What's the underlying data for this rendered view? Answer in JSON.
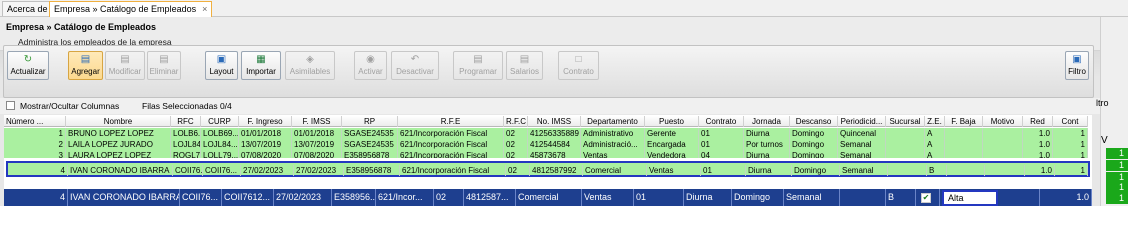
{
  "tabs": [
    {
      "label": "Acerca de"
    },
    {
      "label": "Empresa » Catálogo de Empleados",
      "close": "×"
    }
  ],
  "header": {
    "title": "Empresa » Catálogo de Empleados",
    "subtitle": "Administra los empleados de la empresa"
  },
  "toolbar": {
    "actualizar": "Actualizar",
    "agregar": "Agregar",
    "modificar": "Modificar",
    "eliminar": "Eliminar",
    "layout": "Layout",
    "importar": "Importar",
    "asimilables": "Asimilables",
    "activar": "Activar",
    "desactivar": "Desactivar",
    "programar": "Programar",
    "salarios": "Salarios",
    "contrato": "Contrato",
    "filtro": "Filtro"
  },
  "filter": {
    "toggle_columns": "Mostrar/Ocultar Columnas",
    "selected": "Filas Seleccionadas 0/4"
  },
  "columns": [
    "Número ...",
    "Nombre",
    "RFC",
    "CURP",
    "F. Ingreso",
    "F. IMSS",
    "RP",
    "R.F.E",
    "R.F.C",
    "No. IMSS",
    "Departamento",
    "Puesto",
    "Contrato",
    "Jornada",
    "Descanso",
    "Periodicid...",
    "Sucursal",
    "Z.E.",
    "F. Baja",
    "Motivo",
    "Red",
    "Cont"
  ],
  "rows": [
    [
      "1",
      "BRUNO LOPEZ LOPEZ",
      "LOLB6...",
      "LOLB69...",
      "01/01/2018",
      "01/01/2018",
      "SGASE24535",
      "621/Incorporación Fiscal",
      "02",
      "41256335889",
      "Administrativo",
      "Gerente",
      "01",
      "Diurna",
      "Domingo",
      "Quincenal",
      "",
      "A",
      "",
      "",
      "1.0",
      "1"
    ],
    [
      "2",
      "LAILA LOPEZ JURADO",
      "LOJL84...",
      "LOJL84...",
      "13/07/2019",
      "13/07/2019",
      "SGASE24535",
      "621/Incorporación Fiscal",
      "02",
      "412544584",
      "Administració...",
      "Encargada",
      "01",
      "Por turnos",
      "Domingo",
      "Semanal",
      "",
      "A",
      "",
      "",
      "1.0",
      "1"
    ],
    [
      "3",
      "LAURA LOPEZ LOPEZ",
      "ROGL7...",
      "LOLL79...",
      "07/08/2020",
      "07/08/2020",
      "E358956878",
      "621/Incorporación Fiscal",
      "02",
      "45873678",
      "Ventas",
      "Vendedora",
      "04",
      "Diurna",
      "Domingo",
      "Semanal",
      "",
      "A",
      "",
      "",
      "1.0",
      "1"
    ],
    [
      "4",
      "IVAN CORONADO IBARRA",
      "COII76...",
      "COII76...",
      "27/02/2023",
      "27/02/2023",
      "E358956878",
      "621/Incorporación Fiscal",
      "02",
      "4812587992",
      "Comercial",
      "Ventas",
      "01",
      "Diurna",
      "Domingo",
      "Semanal",
      "",
      "B",
      "",
      "",
      "1.0",
      "1"
    ]
  ],
  "edit_row": [
    "4",
    "IVAN CORONADO IBARRA",
    "COII76...",
    "COII7612...",
    "27/02/2023",
    "E358956...",
    "621/Incor...",
    "02",
    "4812587...",
    "Comercial",
    "Ventas",
    "01",
    "Diurna",
    "Domingo",
    "Semanal",
    "",
    "B",
    "",
    "Alta",
    "",
    "1.0"
  ],
  "right_pane": {
    "tro": "ltro",
    "v": "V",
    "ones": [
      "1",
      "1",
      "1",
      "1",
      "1"
    ]
  }
}
